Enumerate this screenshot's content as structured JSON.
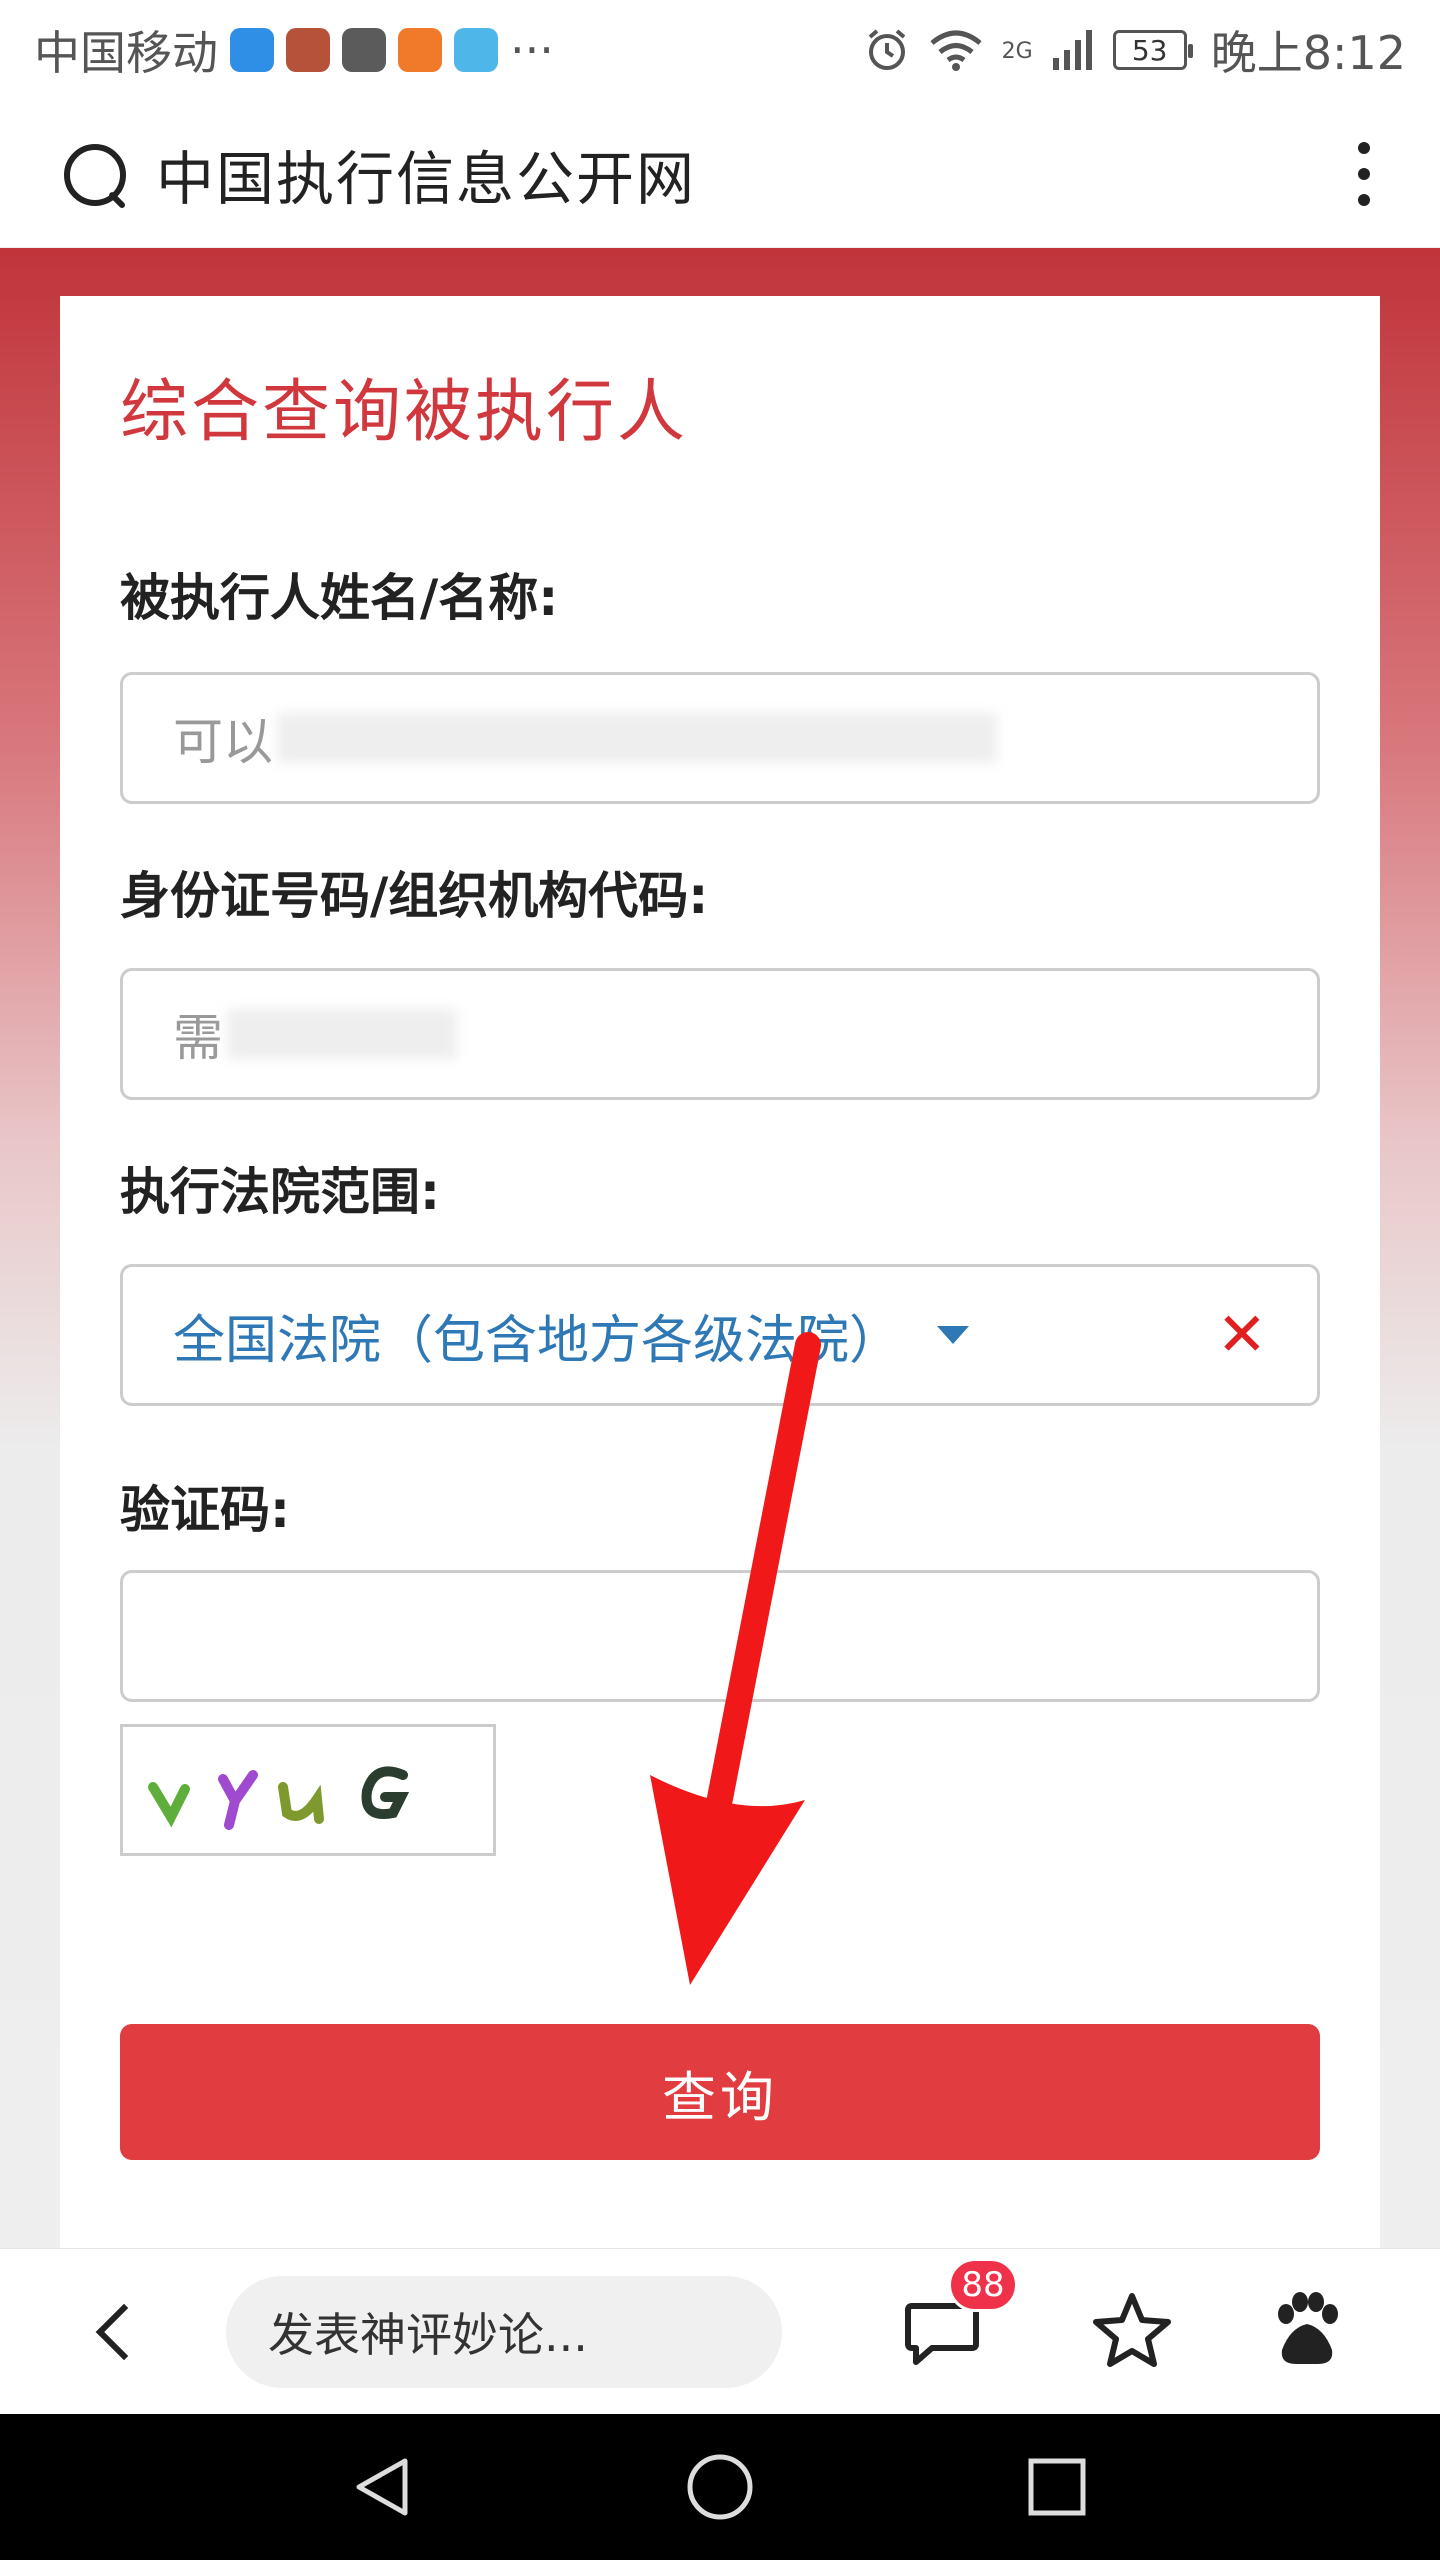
{
  "status_bar": {
    "carrier": "中国移动",
    "network": "2G",
    "battery": "53",
    "time": "晚上8:12",
    "more": "···"
  },
  "browser": {
    "search_text": "中国执行信息公开网"
  },
  "form": {
    "title": "综合查询被执行人",
    "name_label": "被执行人姓名/名称:",
    "name_placeholder_visible": "可以",
    "id_label": "身份证号码/组织机构代码:",
    "id_placeholder_visible": "需",
    "court_label": "执行法院范围:",
    "court_value": "全国法院（包含地方各级法院）",
    "captcha_label": "验证码:",
    "captcha_text": "vYuG",
    "submit_label": "查询"
  },
  "bottom_bar": {
    "comment_placeholder": "发表神评妙论...",
    "comment_count": "88",
    "baidu_text": "du"
  },
  "colors": {
    "brand_red": "#d0383e",
    "button_red": "#e13c40",
    "link_blue": "#2f78b6",
    "badge_red": "#f0314a"
  }
}
